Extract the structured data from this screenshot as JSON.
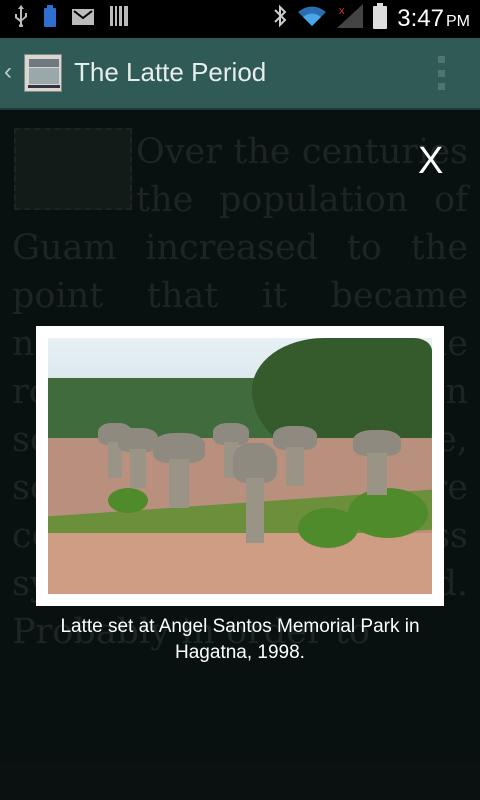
{
  "status_bar": {
    "time": "3:47",
    "ampm": "PM",
    "left_icons": [
      "usb-icon",
      "battery-small-icon",
      "gmail-icon",
      "barcode-icon"
    ],
    "right_icons": [
      "bluetooth-icon",
      "wifi-icon",
      "signal-icon",
      "battery-icon"
    ]
  },
  "action_bar": {
    "title": "The Latte Period",
    "logo": "memorial-center-logo",
    "overflow_icon": "overflow-menu-icon",
    "back_icon": "back-chevron-icon"
  },
  "article": {
    "text": "Over the centuries the population of Guam increased to the point that it became necessary to redefine the roles of the people in society. Over time, societies became more complex, and a class system developed. Probably in order to"
  },
  "dialog": {
    "close_label": "X",
    "caption": "Latte set at Angel Santos Memorial Park in Hagatna, 1998."
  },
  "colors": {
    "action_bar": "#2f5a56",
    "background": "#0f1a19",
    "frame": "#ffffff"
  }
}
